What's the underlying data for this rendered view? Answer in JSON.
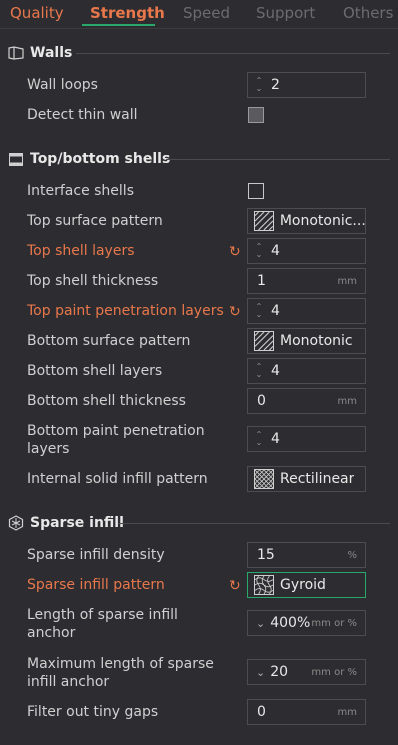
{
  "tabs": [
    {
      "label": "Quality"
    },
    {
      "label": "Strength"
    },
    {
      "label": "Speed"
    },
    {
      "label": "Support"
    },
    {
      "label": "Others"
    }
  ],
  "accent_color": "#2aa86b",
  "modified_color": "#e8774b",
  "sections": {
    "walls": {
      "title": "Walls",
      "wall_loops": {
        "label": "Wall loops",
        "value": "2"
      },
      "detect_thin_wall": {
        "label": "Detect thin wall",
        "checked": true
      }
    },
    "top_bottom": {
      "title": "Top/bottom shells",
      "interface_shells": {
        "label": "Interface shells",
        "checked": false
      },
      "top_surface_pattern": {
        "label": "Top surface pattern",
        "value": "Monotonic..."
      },
      "top_shell_layers": {
        "label": "Top shell layers",
        "value": "4"
      },
      "top_shell_thickness": {
        "label": "Top shell thickness",
        "value": "1",
        "unit": "mm"
      },
      "top_paint_penetration_layers": {
        "label": "Top paint penetration layers",
        "value": "4"
      },
      "bottom_surface_pattern": {
        "label": "Bottom surface pattern",
        "value": "Monotonic"
      },
      "bottom_shell_layers": {
        "label": "Bottom shell layers",
        "value": "4"
      },
      "bottom_shell_thickness": {
        "label": "Bottom shell thickness",
        "value": "0",
        "unit": "mm"
      },
      "bottom_paint_penetration_layers": {
        "label_line1": "Bottom paint penetration",
        "label_line2": "layers",
        "value": "4"
      },
      "internal_solid_infill_pattern": {
        "label": "Internal solid infill pattern",
        "value": "Rectilinear"
      }
    },
    "sparse_infill": {
      "title": "Sparse infill",
      "density": {
        "label": "Sparse infill density",
        "value": "15",
        "unit": "%"
      },
      "pattern": {
        "label": "Sparse infill pattern",
        "value": "Gyroid"
      },
      "anchor_length": {
        "label_line1": "Length of sparse infill",
        "label_line2": "anchor",
        "value": "400%",
        "unit": "mm or %"
      },
      "anchor_max": {
        "label_line1": "Maximum length of sparse",
        "label_line2": "infill anchor",
        "value": "20",
        "unit": "mm or %"
      },
      "filter_gaps": {
        "label": "Filter out tiny gaps",
        "value": "0",
        "unit": "mm"
      }
    }
  }
}
